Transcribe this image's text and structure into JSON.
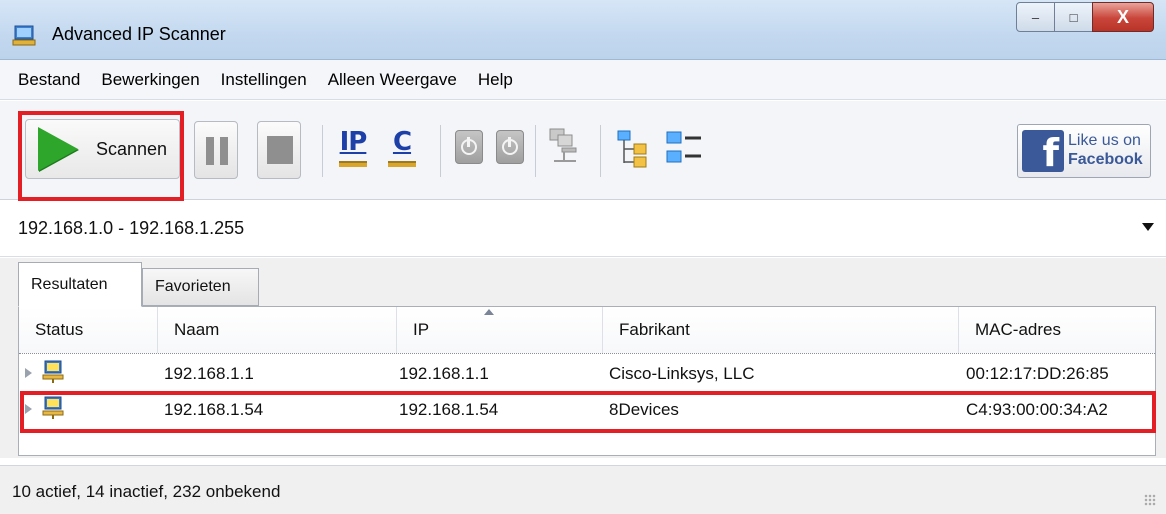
{
  "window": {
    "title": "Advanced IP Scanner",
    "controls": {
      "minimize": "–",
      "maximize": "□",
      "close": "X"
    }
  },
  "menu": [
    {
      "label": "Bestand"
    },
    {
      "label": "Bewerkingen"
    },
    {
      "label": "Instellingen"
    },
    {
      "label": "Alleen Weergave"
    },
    {
      "label": "Help"
    }
  ],
  "toolbar": {
    "scan_label": "Scannen",
    "ip_label": "IP",
    "c_label": "C",
    "facebook": {
      "line1": "Like us on",
      "line2": "Facebook",
      "logo": "f"
    }
  },
  "range": {
    "value": "192.168.1.0 - 192.168.1.255"
  },
  "tabs": [
    {
      "label": "Resultaten",
      "active": true
    },
    {
      "label": "Favorieten",
      "active": false
    }
  ],
  "table": {
    "columns": [
      "Status",
      "Naam",
      "IP",
      "Fabrikant",
      "MAC-adres"
    ],
    "sorted_column": "IP",
    "rows": [
      {
        "name": "192.168.1.1",
        "ip": "192.168.1.1",
        "vendor": "Cisco-Linksys, LLC",
        "mac": "00:12:17:DD:26:85"
      },
      {
        "name": "192.168.1.54",
        "ip": "192.168.1.54",
        "vendor": "8Devices",
        "mac": "C4:93:00:00:34:A2"
      }
    ]
  },
  "status": {
    "text": "10 actief, 14 inactief, 232 onbekend"
  },
  "colors": {
    "highlight": "#e31e24",
    "play": "#2ea52b",
    "facebook": "#3b5998"
  }
}
